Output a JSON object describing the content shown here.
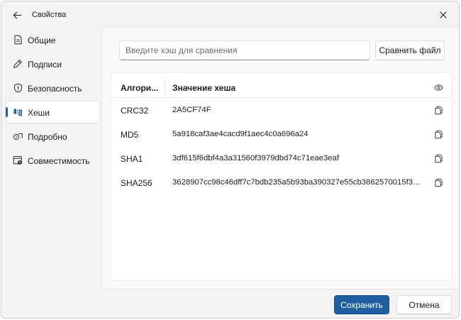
{
  "window": {
    "title": "Свойства"
  },
  "sidebar": {
    "items": [
      {
        "label": "Общие",
        "icon": "document-icon",
        "selected": false
      },
      {
        "label": "Подписи",
        "icon": "pen-icon",
        "selected": false
      },
      {
        "label": "Безопасность",
        "icon": "shield-icon",
        "selected": false
      },
      {
        "label": "Хеши",
        "icon": "hash-icon",
        "selected": true
      },
      {
        "label": "Подробно",
        "icon": "details-icon",
        "selected": false
      },
      {
        "label": "Совместимость",
        "icon": "compatibility-icon",
        "selected": false
      }
    ]
  },
  "compare": {
    "placeholder": "Введите хэш для сравнения",
    "value": "",
    "button_label": "Сравнить файл"
  },
  "table": {
    "headers": {
      "algorithm": "Алгори...",
      "value": "Значение хеша"
    },
    "rows": [
      {
        "algorithm": "CRC32",
        "hash": "2A5CF74F"
      },
      {
        "algorithm": "MD5",
        "hash": "5a918caf3ae4cacd9f1aec4c0a696a24"
      },
      {
        "algorithm": "SHA1",
        "hash": "3df615f6dbf4a3a31560f3979dbd74c71eae3eaf"
      },
      {
        "algorithm": "SHA256",
        "hash": "3628907cc98c46dff7c7bdb235a5b93ba390327e55cb3862570015f3e..."
      }
    ]
  },
  "footer": {
    "save_label": "Сохранить",
    "cancel_label": "Отмена"
  },
  "colors": {
    "accent": "#1f5f9f",
    "window_bg": "#f3f3f3",
    "content_bg": "#f9f9f9"
  }
}
